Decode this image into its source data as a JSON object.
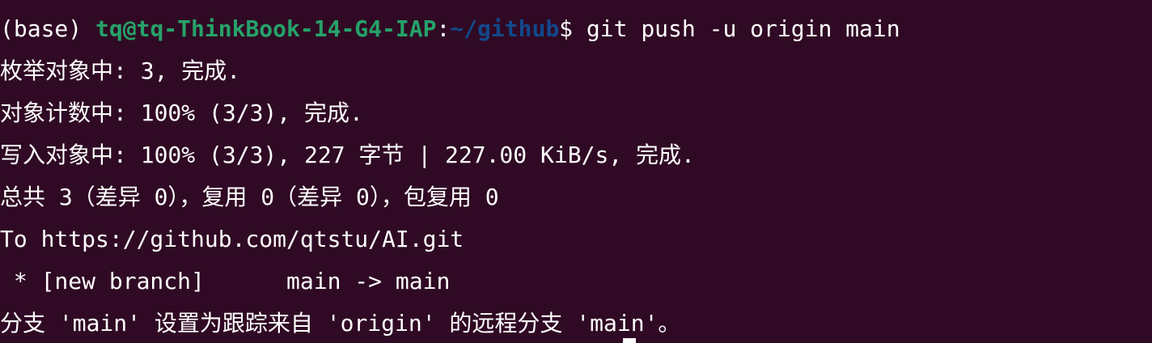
{
  "terminal": {
    "colors": {
      "background": "#300a24",
      "text": "#ffffff",
      "prompt_user": "#26a269",
      "prompt_path": "#12488b"
    },
    "prompt": {
      "env": "(base) ",
      "user_host": "tq@tq-ThinkBook-14-G4-IAP",
      "separator": ":",
      "path": "~/github",
      "symbol": "$ ",
      "command": "git push -u origin main"
    },
    "output": [
      "枚举对象中: 3, 完成.",
      "对象计数中: 100% (3/3), 完成.",
      "写入对象中: 100% (3/3), 227 字节 | 227.00 KiB/s, 完成.",
      "总共 3（差异 0），复用 0（差异 0），包复用 0",
      "To https://github.com/qtstu/AI.git",
      " * [new branch]      main -> main",
      "分支 'main' 设置为跟踪来自 'origin' 的远程分支 'main'。"
    ]
  }
}
